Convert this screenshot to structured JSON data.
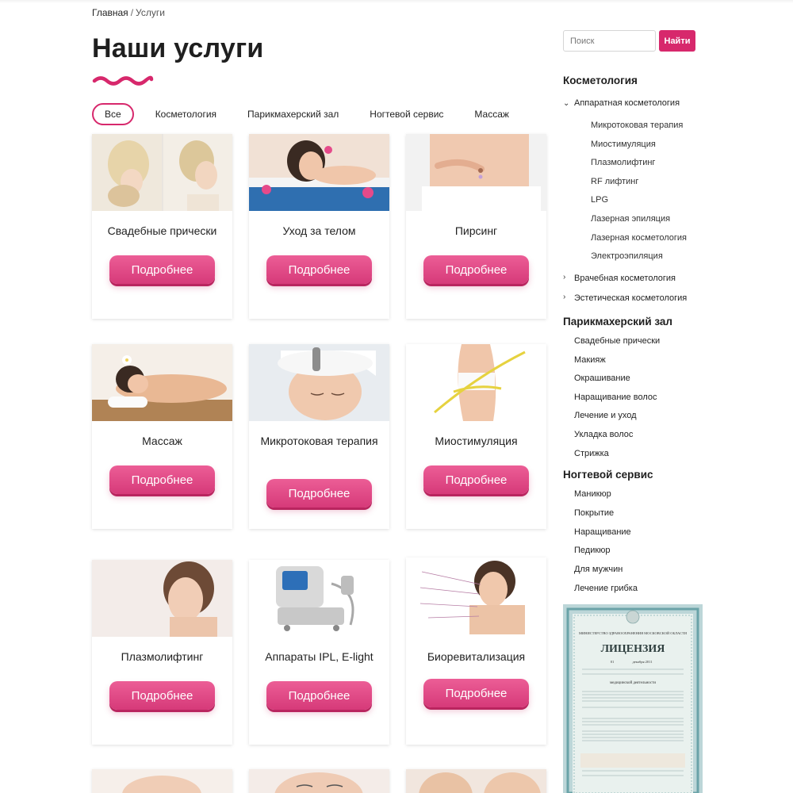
{
  "breadcrumb": {
    "home": "Главная",
    "separator": "/",
    "current": "Услуги"
  },
  "page": {
    "title": "Наши услуги"
  },
  "filters": [
    "Все",
    "Косметология",
    "Парикмахерский зал",
    "Ногтевой сервис",
    "Массаж"
  ],
  "cards": [
    {
      "title": "Свадебные прически",
      "button": "Подробнее"
    },
    {
      "title": "Уход за телом",
      "button": "Подробнее"
    },
    {
      "title": "Пирсинг",
      "button": "Подробнее"
    },
    {
      "title": "Массаж",
      "button": "Подробнее"
    },
    {
      "title": "Микротоковая терапия",
      "button": "Подробнее"
    },
    {
      "title": "Миостимуляция",
      "button": "Подробнее"
    },
    {
      "title": "Плазмолифтинг",
      "button": "Подробнее"
    },
    {
      "title": "Аппараты IPL, E-light",
      "button": "Подробнее"
    },
    {
      "title": "Биоревитализация",
      "button": "Подробнее"
    }
  ],
  "search": {
    "placeholder": "Поиск",
    "button": "Найти"
  },
  "sidebar": {
    "cosmetology": {
      "heading": "Косметология",
      "groups": [
        {
          "label": "Аппаратная косметология",
          "expanded": true,
          "items": [
            "Микротоковая терапия",
            "Миостимуляция",
            "Плазмолифтинг",
            "RF лифтинг",
            "LPG",
            "Лазерная эпиляция",
            "Лазерная косметология",
            "Электроэпиляция"
          ]
        },
        {
          "label": "Врачебная косметология",
          "expanded": false
        },
        {
          "label": "Эстетическая косметология",
          "expanded": false
        }
      ]
    },
    "hair": {
      "heading": "Парикмахерский зал",
      "items": [
        "Свадебные прически",
        "Макияж",
        "Окрашивание",
        "Наращивание волос",
        "Лечение и уход",
        "Укладка волос",
        "Стрижка"
      ]
    },
    "nails": {
      "heading": "Ногтевой сервис",
      "items": [
        "Маникюр",
        "Покрытие",
        "Наращивание",
        "Педикюр",
        "Для мужчин",
        "Лечение грибка"
      ]
    }
  },
  "license": {
    "title": "ЛИЦЕНЗИЯ",
    "issuer": "МИНИСТЕРСТВО ЗДРАВООХРАНЕНИЯ МОСКОВСКОЙ ОБЛАСТИ",
    "activity": "медицинской деятельности",
    "date_month": "декабря 2011",
    "date_day": "01"
  },
  "colors": {
    "accent": "#d7286c",
    "button_top": "#ec5e96",
    "button_bottom": "#d63a79"
  }
}
